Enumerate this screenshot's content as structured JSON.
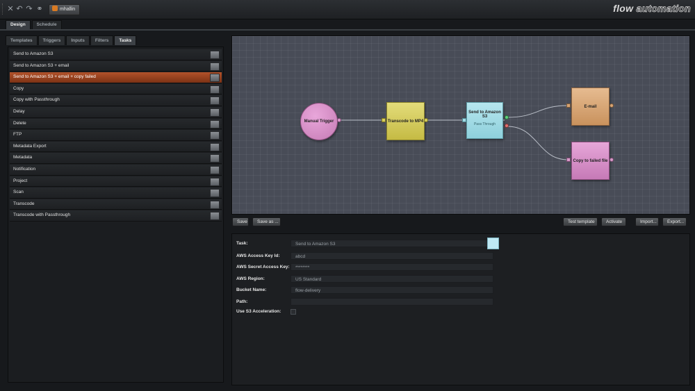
{
  "header": {
    "user": "mhallin",
    "brand_part1": "flow",
    "brand_part2": "automation"
  },
  "main_tabs": [
    "Design",
    "Schedule"
  ],
  "sub_tabs": [
    "Templates",
    "Triggers",
    "Inputs",
    "Filters",
    "Tasks"
  ],
  "task_list": [
    "Send to Amazon S3",
    "Send to Amazon S3 + email",
    "Send to Amazon S3 + email + copy failed",
    "Copy",
    "Copy with Passthrough",
    "Delay",
    "Delete",
    "FTP",
    "Metadata Export",
    "Metadata",
    "Notification",
    "Project",
    "Scan",
    "Transcode",
    "Transcode with Passthrough"
  ],
  "selected_task_index": 2,
  "workflow": {
    "trigger": "Manual Trigger",
    "transcode": "Transcode to MP4",
    "s3": "Send to Amazon S3",
    "s3_sub": "Pass Through",
    "email": "E-mail",
    "copy_failed": "Copy to failed file"
  },
  "toolbar": {
    "save": "Save",
    "save_as": "Save as ...",
    "test_template": "Test template",
    "activate": "Activate",
    "import": "Import...",
    "export": "Export..."
  },
  "properties": {
    "task_label": "Task:",
    "task_value": "Send to Amazon S3",
    "access_key_label": "AWS Access Key Id:",
    "access_key_value": "abcd",
    "secret_key_label": "AWS Secret Access Key:",
    "secret_key_value": "********",
    "region_label": "AWS Region:",
    "region_value": "US Standard",
    "bucket_label": "Bucket Name:",
    "bucket_value": "flow-delivery",
    "path_label": "Path:",
    "path_value": "",
    "accel_label": "Use S3 Acceleration:"
  },
  "colors": {
    "selected_row": "#9c4220",
    "task_swatch": "#bfe9f4"
  }
}
